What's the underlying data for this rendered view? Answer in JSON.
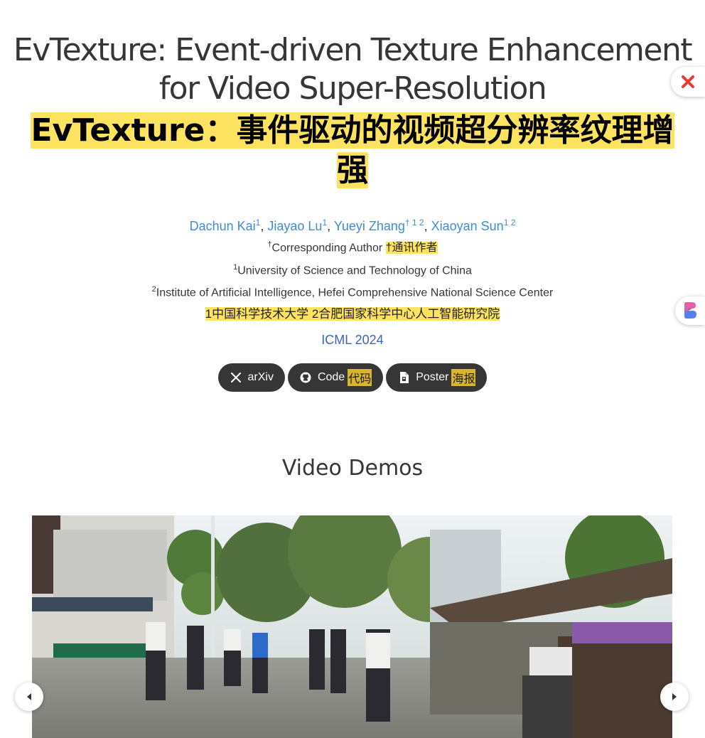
{
  "title": {
    "en": "EvTexture: Event-driven Texture Enhancement for Video Super-Resolution",
    "cn_line1": "EvTexture：事件驱动的视频超分辨率纹理增",
    "cn_line2": "强"
  },
  "authors": [
    {
      "name": "Dachun Kai",
      "sup": "1"
    },
    {
      "name": "Jiayao Lu",
      "sup": "1"
    },
    {
      "name": "Yueyi Zhang",
      "sup": "† 1 2"
    },
    {
      "name": "Xiaoyan Sun",
      "sup": "1 2"
    }
  ],
  "corresponding": {
    "mark": "†",
    "text": "Corresponding Author",
    "cn": "†通讯作者"
  },
  "affiliations": [
    {
      "sup": "1",
      "text": "University of Science and Technology of China"
    },
    {
      "sup": "2",
      "text": "Institute of Artificial Intelligence, Hefei Comprehensive National Science Center"
    }
  ],
  "affiliations_cn": "1中国科学技术大学 2合肥国家科学中心人工智能研究院",
  "venue": "ICML 2024",
  "buttons": [
    {
      "label": "arXiv",
      "cn": "",
      "icon": "x-icon"
    },
    {
      "label": "Code",
      "cn": "代码",
      "icon": "github-icon"
    },
    {
      "label": "Poster",
      "cn": "海报",
      "icon": "file-pdf-icon"
    }
  ],
  "section": {
    "video_demos": "Video Demos"
  },
  "colors": {
    "link": "#3b8dd6",
    "highlight": "#fde360",
    "button_bg": "#363636",
    "venue": "#3a66b8"
  }
}
